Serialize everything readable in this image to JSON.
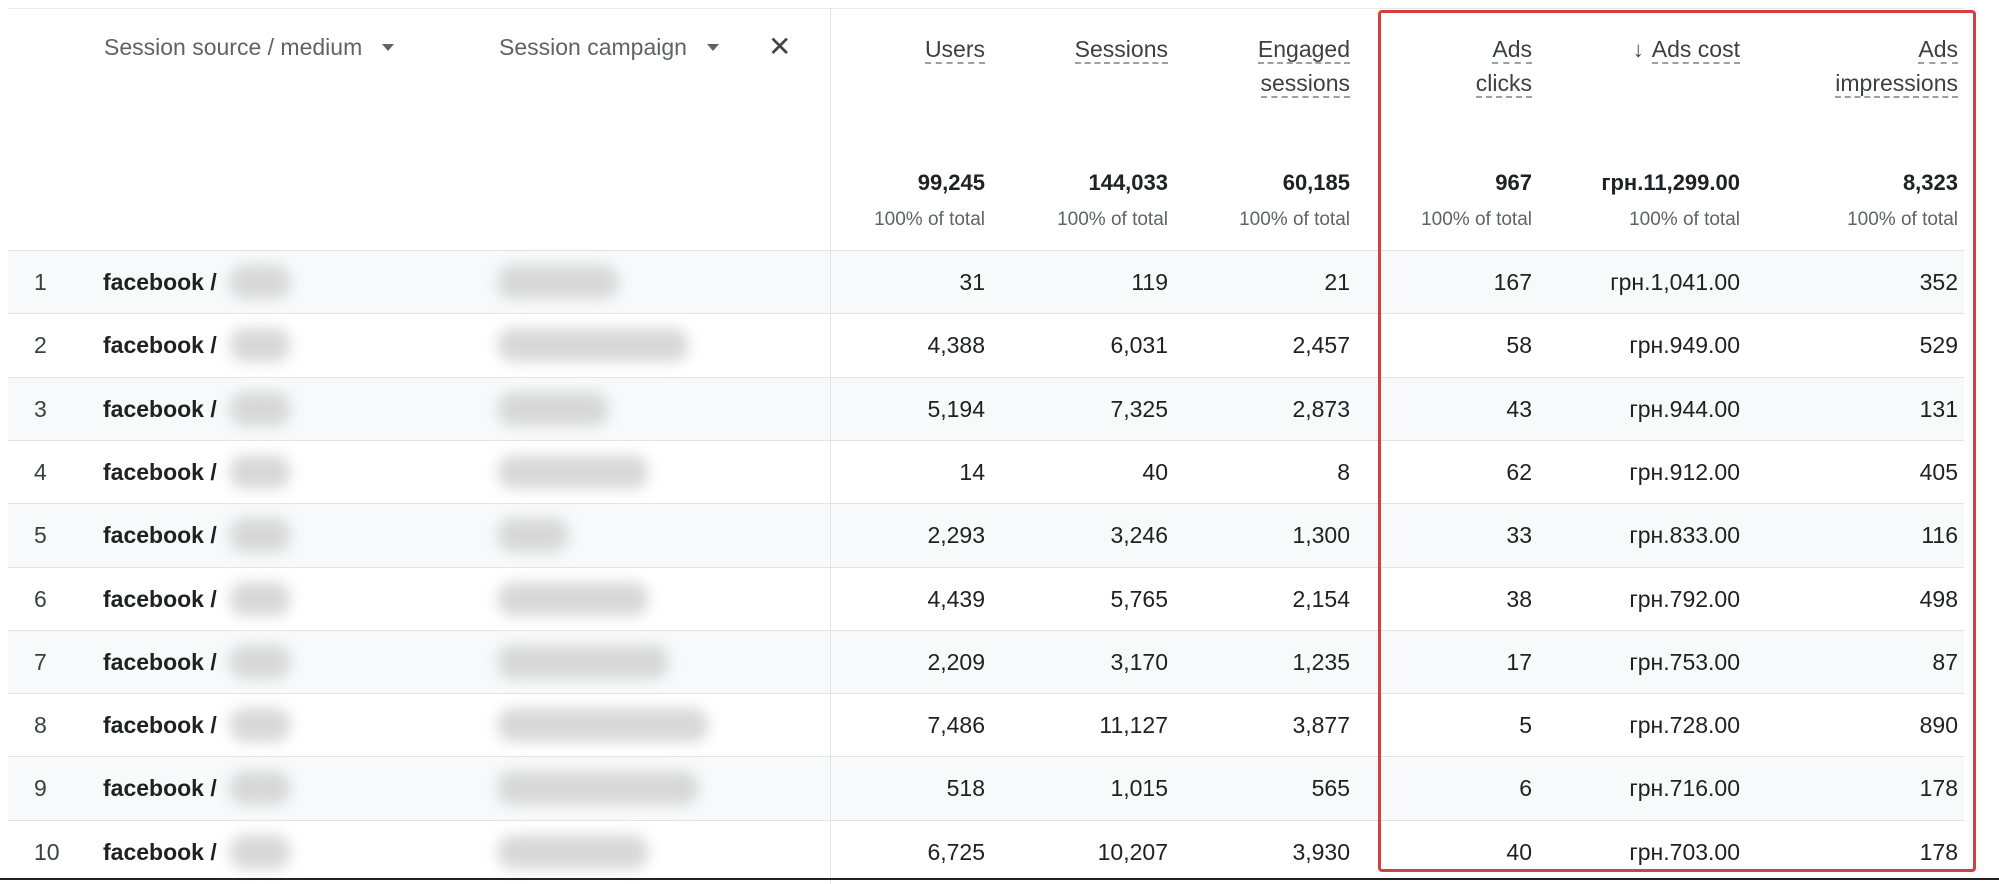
{
  "dimensions": {
    "source_medium_label": "Session source / medium",
    "campaign_label": "Session campaign"
  },
  "metrics": [
    {
      "key": "users",
      "label_lines": [
        "Users"
      ],
      "total": "99,245",
      "pct": "100% of total",
      "sorted": false
    },
    {
      "key": "sessions",
      "label_lines": [
        "Sessions"
      ],
      "total": "144,033",
      "pct": "100% of total",
      "sorted": false
    },
    {
      "key": "engaged",
      "label_lines": [
        "Engaged",
        "sessions"
      ],
      "total": "60,185",
      "pct": "100% of total",
      "sorted": false
    },
    {
      "key": "ads_clicks",
      "label_lines": [
        "Ads",
        "clicks"
      ],
      "total": "967",
      "pct": "100% of total",
      "sorted": false
    },
    {
      "key": "ads_cost",
      "label_lines": [
        "Ads cost"
      ],
      "total": "грн.11,299.00",
      "pct": "100% of total",
      "sorted": true
    },
    {
      "key": "ads_impressions",
      "label_lines": [
        "Ads",
        "impressions"
      ],
      "total": "8,323",
      "pct": "100% of total",
      "sorted": false
    }
  ],
  "rows": [
    {
      "index": "1",
      "source": "facebook /",
      "values": [
        "31",
        "119",
        "21",
        "167",
        "грн.1,041.00",
        "352"
      ]
    },
    {
      "index": "2",
      "source": "facebook /",
      "values": [
        "4,388",
        "6,031",
        "2,457",
        "58",
        "грн.949.00",
        "529"
      ]
    },
    {
      "index": "3",
      "source": "facebook /",
      "values": [
        "5,194",
        "7,325",
        "2,873",
        "43",
        "грн.944.00",
        "131"
      ]
    },
    {
      "index": "4",
      "source": "facebook /",
      "values": [
        "14",
        "40",
        "8",
        "62",
        "грн.912.00",
        "405"
      ]
    },
    {
      "index": "5",
      "source": "facebook /",
      "values": [
        "2,293",
        "3,246",
        "1,300",
        "33",
        "грн.833.00",
        "116"
      ]
    },
    {
      "index": "6",
      "source": "facebook /",
      "values": [
        "4,439",
        "5,765",
        "2,154",
        "38",
        "грн.792.00",
        "498"
      ]
    },
    {
      "index": "7",
      "source": "facebook /",
      "values": [
        "2,209",
        "3,170",
        "1,235",
        "17",
        "грн.753.00",
        "87"
      ]
    },
    {
      "index": "8",
      "source": "facebook /",
      "values": [
        "7,486",
        "11,127",
        "3,877",
        "5",
        "грн.728.00",
        "890"
      ]
    },
    {
      "index": "9",
      "source": "facebook /",
      "values": [
        "518",
        "1,015",
        "565",
        "6",
        "грн.716.00",
        "178"
      ]
    },
    {
      "index": "10",
      "source": "facebook /",
      "values": [
        "6,725",
        "10,207",
        "3,930",
        "40",
        "грн.703.00",
        "178"
      ]
    }
  ],
  "colors": {
    "highlight": "#d14141",
    "row_alt": "#f8f9fa",
    "divider": "#e3e3e3"
  }
}
